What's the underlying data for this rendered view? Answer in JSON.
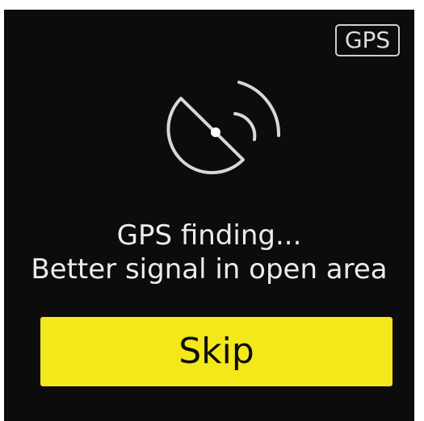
{
  "badge": {
    "label": "GPS"
  },
  "status": {
    "line1": "GPS finding...",
    "line2": "Better signal in open area"
  },
  "actions": {
    "skip_label": "Skip"
  },
  "icons": {
    "center": "gps-satellite-icon"
  },
  "colors": {
    "screen_background": "#0c0c0c",
    "text": "#ececec",
    "button": "#f2e81a",
    "button_text": "#0d0d0d"
  }
}
